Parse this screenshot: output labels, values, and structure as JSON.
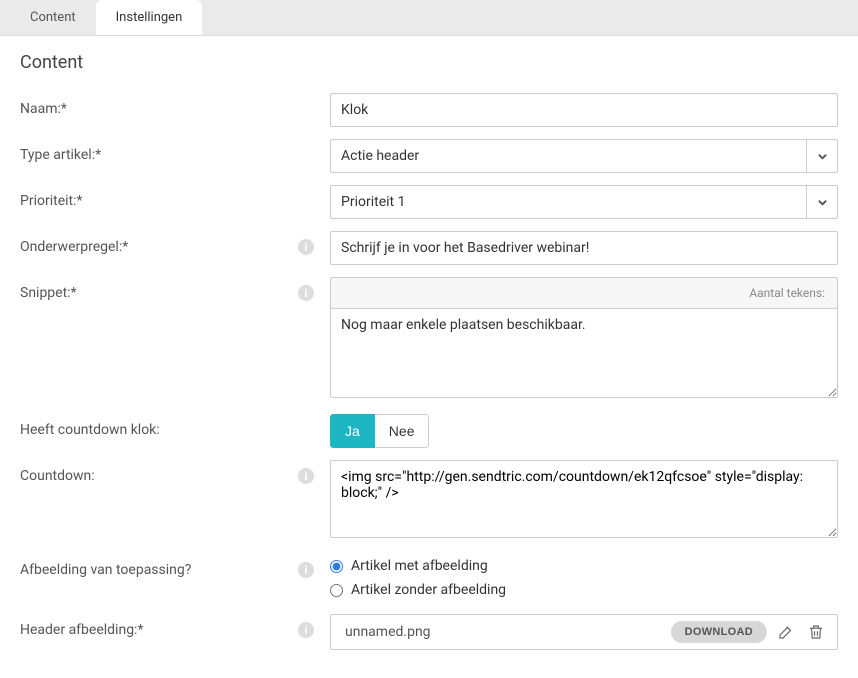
{
  "tabs": {
    "content": "Content",
    "settings": "Instellingen"
  },
  "page_title": "Content",
  "labels": {
    "naam": "Naam:*",
    "type_artikel": "Type artikel:*",
    "prioriteit": "Prioriteit:*",
    "onderwerpregel": "Onderwerpregel:*",
    "snippet": "Snippet:*",
    "heeft_countdown": "Heeft countdown klok:",
    "countdown": "Countdown:",
    "afbeelding_toepassing": "Afbeelding van toepassing?",
    "header_afbeelding": "Header afbeelding:*"
  },
  "values": {
    "naam": "Klok",
    "type_artikel": "Actie header",
    "prioriteit": "Prioriteit 1",
    "onderwerpregel": "Schrijf je in voor het Basedriver webinar!",
    "snippet": "Nog maar enkele plaatsen beschikbaar.",
    "countdown_embed": "<img src=\"http://gen.sendtric.com/countdown/ek12qfcsoe\" style=\"display: block;\" />",
    "header_file": "unnamed.png"
  },
  "snippet_charcount_label": "Aantal tekens:",
  "toggle": {
    "ja": "Ja",
    "nee": "Nee"
  },
  "radio": {
    "met": "Artikel met afbeelding",
    "zonder": "Artikel zonder afbeelding"
  },
  "download_label": "DOWNLOAD"
}
